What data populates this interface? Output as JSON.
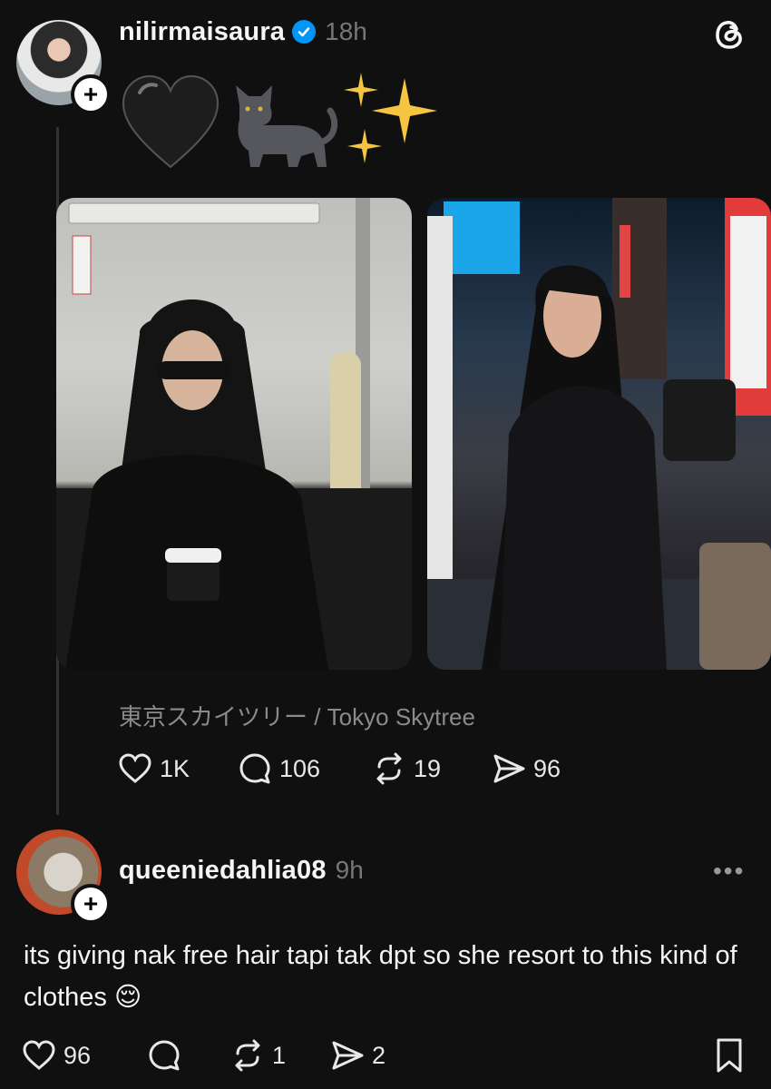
{
  "post": {
    "username": "nilirmaisaura",
    "time": "18h",
    "emojis": "🖤🐈‍⬛✨",
    "location": "東京スカイツリー / Tokyo Skytree",
    "stats": {
      "likes": "1K",
      "replies": "106",
      "reposts": "19",
      "shares": "96"
    }
  },
  "reply": {
    "username": "queeniedahlia08",
    "time": "9h",
    "text": "its giving nak free hair tapi tak dpt so she resort to this kind of clothes 😌",
    "stats": {
      "likes": "96",
      "replies": "",
      "reposts": "1",
      "shares": "2"
    }
  },
  "icons": {
    "app_logo": "threads-logo-icon",
    "verified": "verified-badge-icon",
    "like": "heart-icon",
    "reply": "comment-icon",
    "repost": "repost-icon",
    "share": "share-icon",
    "more": "more-icon",
    "bookmark": "bookmark-icon"
  },
  "colors": {
    "background": "#101010",
    "verified": "#0095f6",
    "muted": "#777777"
  }
}
